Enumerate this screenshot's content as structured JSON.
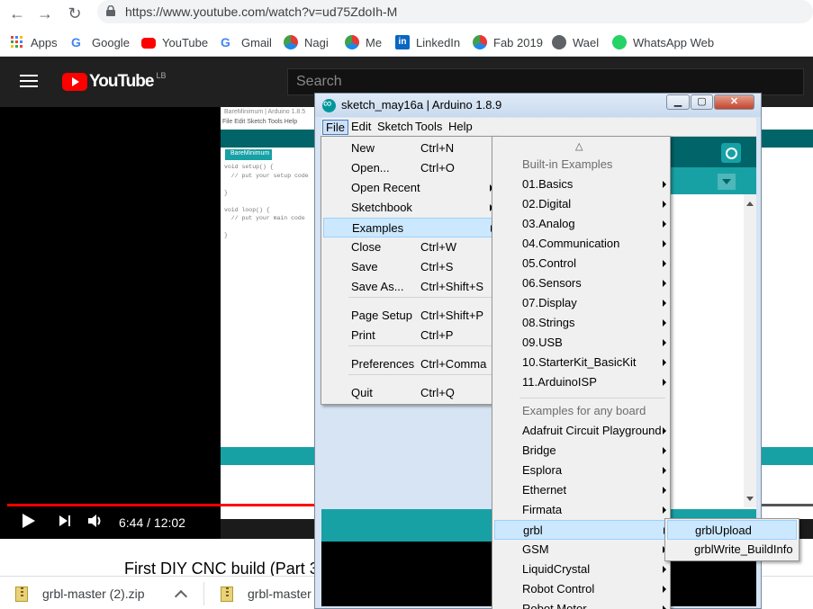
{
  "browser": {
    "url": "https://www.youtube.com/watch?v=ud75ZdoIh-M",
    "bookmarks": [
      {
        "label": "Apps",
        "icon": "apps-grid-icon"
      },
      {
        "label": "Google",
        "icon": "google-icon"
      },
      {
        "label": "YouTube",
        "icon": "youtube-icon"
      },
      {
        "label": "Gmail",
        "icon": "google-icon"
      },
      {
        "label": "Nagi",
        "icon": "fablab-icon"
      },
      {
        "label": "Me",
        "icon": "fablab-icon"
      },
      {
        "label": "LinkedIn",
        "icon": "linkedin-icon"
      },
      {
        "label": "Fab 2019",
        "icon": "fablab-icon"
      },
      {
        "label": "Wael",
        "icon": "globe-icon"
      },
      {
        "label": "WhatsApp Web",
        "icon": "whatsapp-icon"
      }
    ]
  },
  "youtube": {
    "logo_text": "YouTube",
    "region": "LB",
    "search_placeholder": "Search",
    "time": "6:44 / 12:02",
    "progress_fraction": 0.56,
    "video_title": "First DIY CNC build (Part 3"
  },
  "video_frame": {
    "title": "BareMinimum | Arduino 1.8.5",
    "menu": "File  Edit  Sketch  Tools  Help",
    "tab": "BareMinimum",
    "code": "void setup() {\n  // put your setup code\n\n}\n\nvoid loop() {\n  // put your main code\n\n}"
  },
  "arduino": {
    "title": "sketch_may16a | Arduino 1.8.9",
    "menubar": [
      "File",
      "Edit",
      "Sketch",
      "Tools",
      "Help"
    ],
    "file_menu": [
      {
        "label": "New",
        "shortcut": "Ctrl+N"
      },
      {
        "label": "Open...",
        "shortcut": "Ctrl+O"
      },
      {
        "label": "Open Recent",
        "shortcut": ""
      },
      {
        "label": "Sketchbook",
        "shortcut": ""
      },
      {
        "label": "Examples",
        "shortcut": ""
      },
      {
        "label": "Close",
        "shortcut": "Ctrl+W"
      },
      {
        "label": "Save",
        "shortcut": "Ctrl+S"
      },
      {
        "label": "Save As...",
        "shortcut": "Ctrl+Shift+S"
      },
      {
        "label": "Page Setup",
        "shortcut": "Ctrl+Shift+P"
      },
      {
        "label": "Print",
        "shortcut": "Ctrl+P"
      },
      {
        "label": "Preferences",
        "shortcut": "Ctrl+Comma"
      },
      {
        "label": "Quit",
        "shortcut": "Ctrl+Q"
      }
    ],
    "examples_menu": {
      "scroll_up": "△",
      "builtin_header": "Built-in Examples",
      "builtin": [
        "01.Basics",
        "02.Digital",
        "03.Analog",
        "04.Communication",
        "05.Control",
        "06.Sensors",
        "07.Display",
        "08.Strings",
        "09.USB",
        "10.StarterKit_BasicKit",
        "11.ArduinoISP"
      ],
      "board_header": "Examples for any board",
      "board": [
        "Adafruit Circuit Playground",
        "Bridge",
        "Esplora",
        "Ethernet",
        "Firmata",
        "grbl",
        "GSM",
        "LiquidCrystal",
        "Robot Control",
        "Robot Motor"
      ]
    },
    "grbl_menu": [
      "grblUpload",
      "grblWrite_BuildInfo"
    ]
  },
  "downloads": [
    {
      "label": "grbl-master (2).zip"
    },
    {
      "label": "grbl-master ("
    }
  ]
}
